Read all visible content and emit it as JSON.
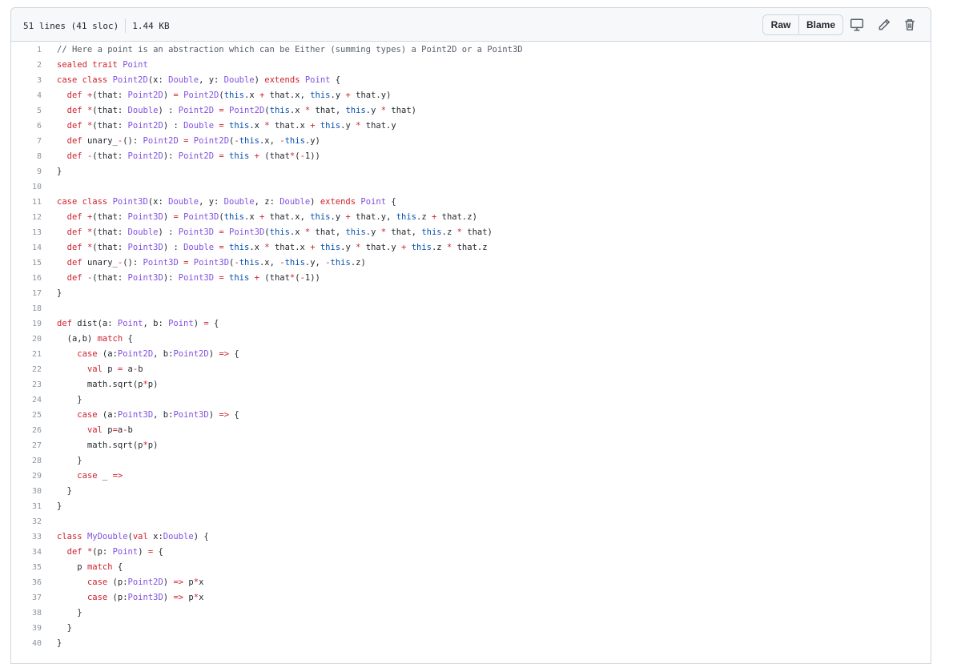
{
  "file_header": {
    "lines_info": "51 lines (41 sloc)",
    "size": "1.44 KB",
    "raw_label": "Raw",
    "blame_label": "Blame",
    "icons": [
      "desktop-icon",
      "pencil-icon",
      "trash-icon"
    ]
  },
  "code_lines": [
    "// Here a point is an abstraction which can be Either (summing types) a Point2D or a Point3D",
    "sealed trait Point",
    "case class Point2D(x: Double, y: Double) extends Point {",
    "  def +(that: Point2D) = Point2D(this.x + that.x, this.y + that.y)",
    "  def *(that: Double) : Point2D = Point2D(this.x * that, this.y * that)",
    "  def *(that: Point2D) : Double = this.x * that.x + this.y * that.y",
    "  def unary_-(): Point2D = Point2D(-this.x, -this.y)",
    "  def -(that: Point2D): Point2D = this + (that*(-1))",
    "}",
    "",
    "case class Point3D(x: Double, y: Double, z: Double) extends Point {",
    "  def +(that: Point3D) = Point3D(this.x + that.x, this.y + that.y, this.z + that.z)",
    "  def *(that: Double) : Point3D = Point3D(this.x * that, this.y * that, this.z * that)",
    "  def *(that: Point3D) : Double = this.x * that.x + this.y * that.y + this.z * that.z",
    "  def unary_-(): Point3D = Point3D(-this.x, -this.y, -this.z)",
    "  def -(that: Point3D): Point3D = this + (that*(-1))",
    "}",
    "",
    "def dist(a: Point, b: Point) = {",
    "  (a,b) match {",
    "    case (a:Point2D, b:Point2D) => {",
    "      val p = a-b",
    "      math.sqrt(p*p)",
    "    }",
    "    case (a:Point3D, b:Point3D) => {",
    "      val p=a-b",
    "      math.sqrt(p*p)",
    "    }",
    "    case _ =>",
    "  }",
    "}",
    "",
    "class MyDouble(val x:Double) {",
    "  def *(p: Point) = {",
    "    p match {",
    "      case (p:Point2D) => p*x",
    "      case (p:Point3D) => p*x",
    "    }",
    "  }",
    "}"
  ]
}
